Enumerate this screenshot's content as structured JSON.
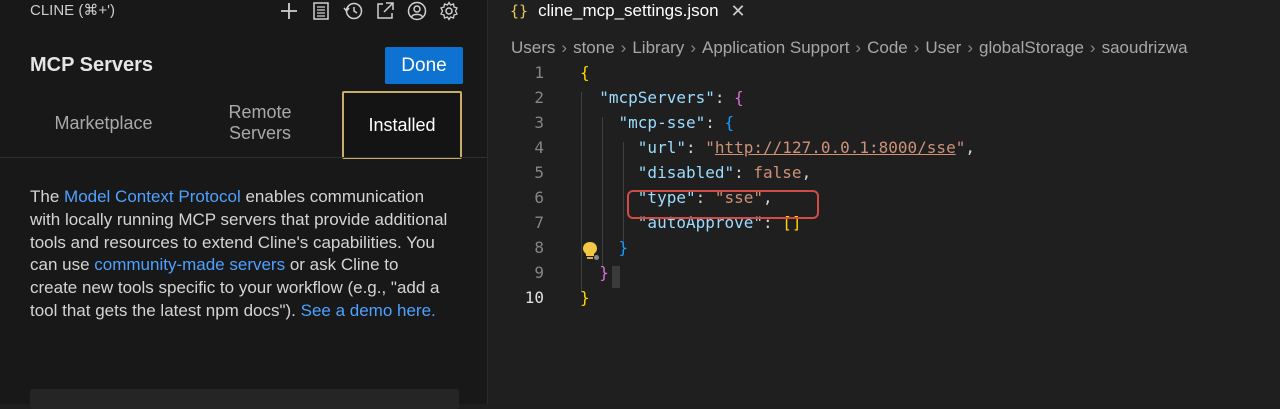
{
  "sidebar": {
    "panel_title": "CLINE (⌘+')",
    "header_icons": [
      "plus-icon",
      "history-list-icon",
      "history-clock-icon",
      "external-link-icon",
      "account-icon",
      "gear-icon"
    ],
    "title": "MCP Servers",
    "done_label": "Done",
    "tabs": [
      {
        "label": "Marketplace"
      },
      {
        "label": "Remote Servers"
      },
      {
        "label": "Installed",
        "active": true
      }
    ],
    "description": {
      "p1": "The ",
      "link1": "Model Context Protocol",
      "p2": " enables communication with locally running MCP servers that provide additional tools and resources to extend Cline's capabilities. You can use ",
      "link2": "community-made servers",
      "p3": " or ask Cline to create new tools specific to your workflow (e.g., \"add a tool that gets the latest npm docs\"). ",
      "link3": "See a demo here."
    }
  },
  "editor": {
    "tab_icon": "{}",
    "tab_filename": "cline_mcp_settings.json",
    "breadcrumb": [
      "Users",
      "stone",
      "Library",
      "Application Support",
      "Code",
      "User",
      "globalStorage",
      "saoudrizwa"
    ],
    "line_numbers": [
      "1",
      "2",
      "3",
      "4",
      "5",
      "6",
      "7",
      "8",
      "9",
      "10"
    ],
    "code": {
      "l2_key": "\"mcpServers\"",
      "l3_key": "\"mcp-sse\"",
      "l4_key": "\"url\"",
      "l4_q": "\"",
      "l4_url": "http://127.0.0.1:8000/sse",
      "l5_key": "\"disabled\"",
      "l5_val": "false",
      "l6_key": "\"type\"",
      "l6_val": "\"sse\"",
      "l7_key": "\"autoApprove\"",
      "l7_val": "[]"
    },
    "colors": {
      "highlight_box": "#d24a44",
      "installed_tab_border": "#c7ae6a",
      "done_button": "#0e73d0",
      "link": "#4ea1ff"
    }
  }
}
